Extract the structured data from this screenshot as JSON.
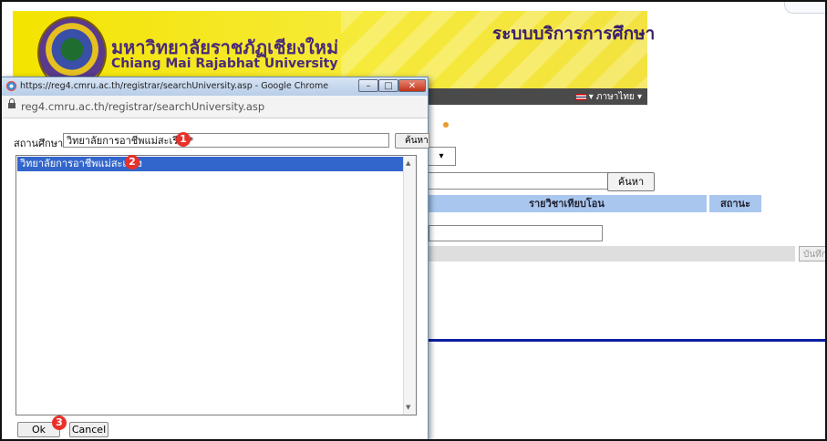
{
  "background_page": {
    "university_name_th": "มหาวิทยาลัยราชภัฏเชียงใหม่",
    "university_name_en": "Chiang Mai Rajabhat University",
    "system_title": "ระบบบริการการศึกษา",
    "language_menu": "▾ ภาษาไทย ▾",
    "select_a_value": "▾",
    "select_b_value": "▾",
    "search_button": "ค้นหา",
    "table_headers": [
      "รายวิชาเทียบโอน",
      "สถานะ"
    ],
    "save_button": "บันทึก"
  },
  "popup": {
    "window_title": "https://reg4.cmru.ac.th/registrar/searchUniversity.asp - Google Chrome",
    "window_buttons": {
      "minimize": "–",
      "maximize": "□",
      "close": "✕"
    },
    "url": "reg4.cmru.ac.th/registrar/searchUniversity.asp",
    "school_label": "สถานศึกษา",
    "school_input_value": "วิทยาลัยการอาชีพแม่สะเรียง*",
    "search_button": "ค้นหา",
    "list_items": [
      "วิทยาลัยการอาชีพแม่สะเรียง"
    ],
    "ok_button": "Ok",
    "cancel_button": "Cancel"
  },
  "step_badges": [
    "1",
    "2",
    "3"
  ],
  "colors": {
    "header_yellow": "#f3e400",
    "selection_blue": "#3366cc",
    "table_header_blue": "#a9c7ee",
    "badge_red": "#e8312a",
    "divider_blue": "#0a1fa0"
  }
}
